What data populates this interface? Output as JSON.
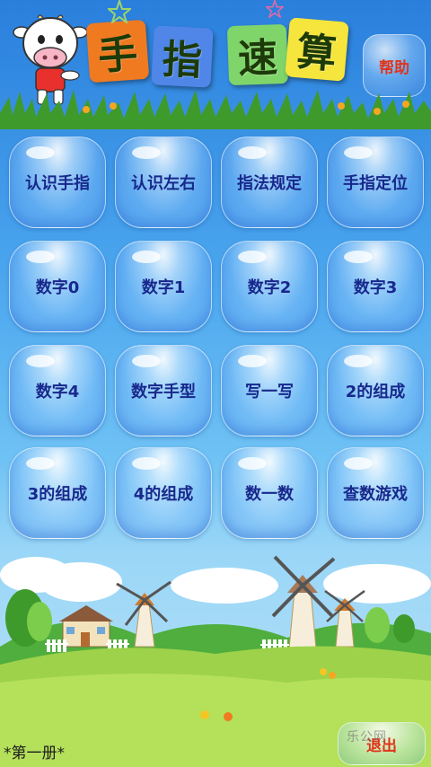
{
  "header": {
    "title_chars": [
      "手",
      "指",
      "速",
      "算"
    ],
    "title_colors": [
      "#f07a20",
      "#4f86e8",
      "#7fd46a",
      "#f5e53c"
    ],
    "help_label": "帮助"
  },
  "buttons": [
    "认识手指",
    "认识左右",
    "指法规定",
    "手指定位",
    "数字0",
    "数字1",
    "数字2",
    "数字3",
    "数字4",
    "数字手型",
    "写一写",
    "2的组成",
    "3的组成",
    "4的组成",
    "数一数",
    "查数游戏"
  ],
  "footer": {
    "volume_label": "*第一册*",
    "exit_label": "退出",
    "watermark": "乐公网"
  },
  "colors": {
    "button_text": "#18288c",
    "help_text": "#e0341a"
  }
}
